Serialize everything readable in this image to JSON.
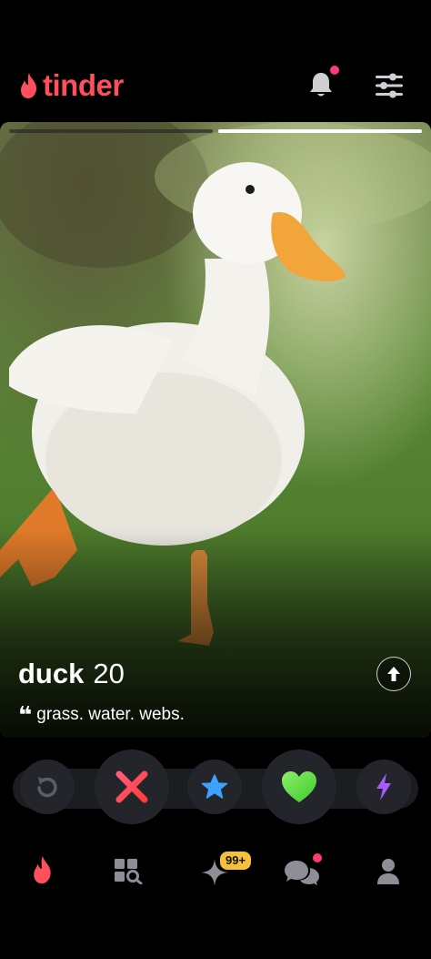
{
  "header": {
    "logo_text": "tinder",
    "brand_color": "#fd4f5e",
    "icons": [
      "flame-icon",
      "bell-icon",
      "filters-icon"
    ],
    "notification_dot": true
  },
  "card": {
    "photo_count": 2,
    "active_photo_index": 2,
    "name": "duck",
    "age": "20",
    "bio_quote_mark": "❝",
    "bio": "grass. water. webs."
  },
  "actions": [
    {
      "name": "rewind",
      "icon": "rewind-icon"
    },
    {
      "name": "nope",
      "icon": "x-icon"
    },
    {
      "name": "super-like",
      "icon": "star-icon"
    },
    {
      "name": "like",
      "icon": "heart-icon"
    },
    {
      "name": "boost",
      "icon": "bolt-icon"
    }
  ],
  "tabs": [
    {
      "name": "swipe",
      "icon": "flame-icon",
      "active": true
    },
    {
      "name": "explore",
      "icon": "explore-grid-icon"
    },
    {
      "name": "likes",
      "icon": "sparkle-icon",
      "badge": "99+"
    },
    {
      "name": "chat",
      "icon": "chat-icon",
      "notification_dot": true
    },
    {
      "name": "profile",
      "icon": "profile-icon"
    }
  ],
  "colors": {
    "accent": "#fd4f5e",
    "nope": "#ff4458",
    "super_like": "#3ea0ff",
    "like": "#6fe04b",
    "boost": "#a65cff",
    "badge": "#f6c138"
  }
}
